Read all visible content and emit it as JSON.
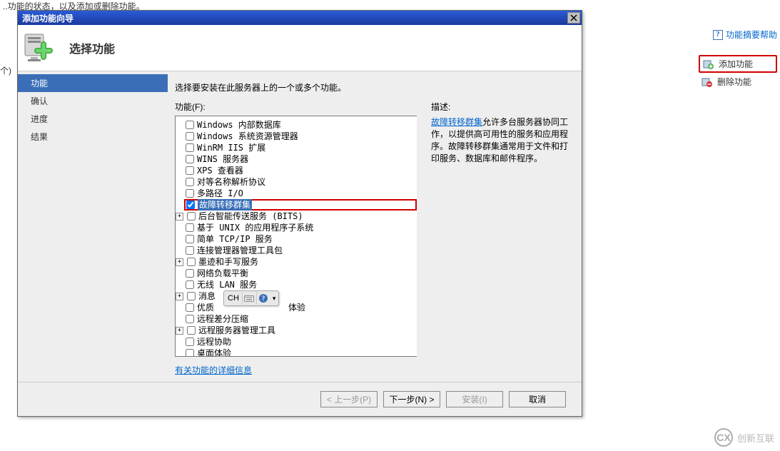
{
  "background": {
    "top_text": "..功能的状态，以及添加或删除功能。",
    "crumb": "个)"
  },
  "right_panel": {
    "help_label": "功能摘要帮助",
    "add_feature": "添加功能",
    "remove_feature": "删除功能"
  },
  "dialog": {
    "title": "添加功能向导",
    "header_title": "选择功能",
    "sidebar": {
      "items": [
        {
          "label": "功能",
          "active": true
        },
        {
          "label": "确认",
          "active": false
        },
        {
          "label": "进度",
          "active": false
        },
        {
          "label": "结果",
          "active": false
        }
      ]
    },
    "content": {
      "instruction": "选择要安装在此服务器上的一个或多个功能。",
      "features_label": "功能(F):",
      "desc_label": "描述:",
      "features": [
        {
          "label": "Windows 内部数据库",
          "checked": false
        },
        {
          "label": "Windows 系统资源管理器",
          "checked": false
        },
        {
          "label": "WinRM IIS 扩展",
          "checked": false
        },
        {
          "label": "WINS 服务器",
          "checked": false
        },
        {
          "label": "XPS 查看器",
          "checked": false
        },
        {
          "label": "对等名称解析协议",
          "checked": false
        },
        {
          "label": "多路径 I/O",
          "checked": false
        },
        {
          "label": "故障转移群集",
          "checked": true,
          "selected": true
        },
        {
          "label": "后台智能传送服务 (BITS)",
          "checked": false,
          "expandable": true
        },
        {
          "label": "基于 UNIX 的应用程序子系统",
          "checked": false
        },
        {
          "label": "简单 TCP/IP 服务",
          "checked": false
        },
        {
          "label": "连接管理器管理工具包",
          "checked": false
        },
        {
          "label": "墨迹和手写服务",
          "checked": false,
          "expandable": true
        },
        {
          "label": "网络负载平衡",
          "checked": false
        },
        {
          "label": "无线 LAN 服务",
          "checked": false
        },
        {
          "label": "消息",
          "checked": false,
          "expandable": true,
          "partial": true
        },
        {
          "label": "优质",
          "partial_suffix": "体验",
          "checked": false
        },
        {
          "label": "远程差分压缩",
          "checked": false
        },
        {
          "label": "远程服务器管理工具",
          "checked": false,
          "expandable": true
        },
        {
          "label": "远程协助",
          "checked": false
        },
        {
          "label": "桌面体验",
          "checked": false
        }
      ],
      "description_link": "故障转移群集",
      "description_rest": "允许多台服务器协同工作，以提供高可用性的服务和应用程序。故障转移群集通常用于文件和打印服务、数据库和邮件程序。",
      "details_link": "有关功能的详细信息"
    },
    "footer": {
      "prev": "< 上一步(P)",
      "next": "下一步(N) >",
      "install": "安装(I)",
      "cancel": "取消"
    }
  },
  "floating_toolbar": {
    "label": "CH"
  },
  "watermark": {
    "text": "创新互联"
  }
}
